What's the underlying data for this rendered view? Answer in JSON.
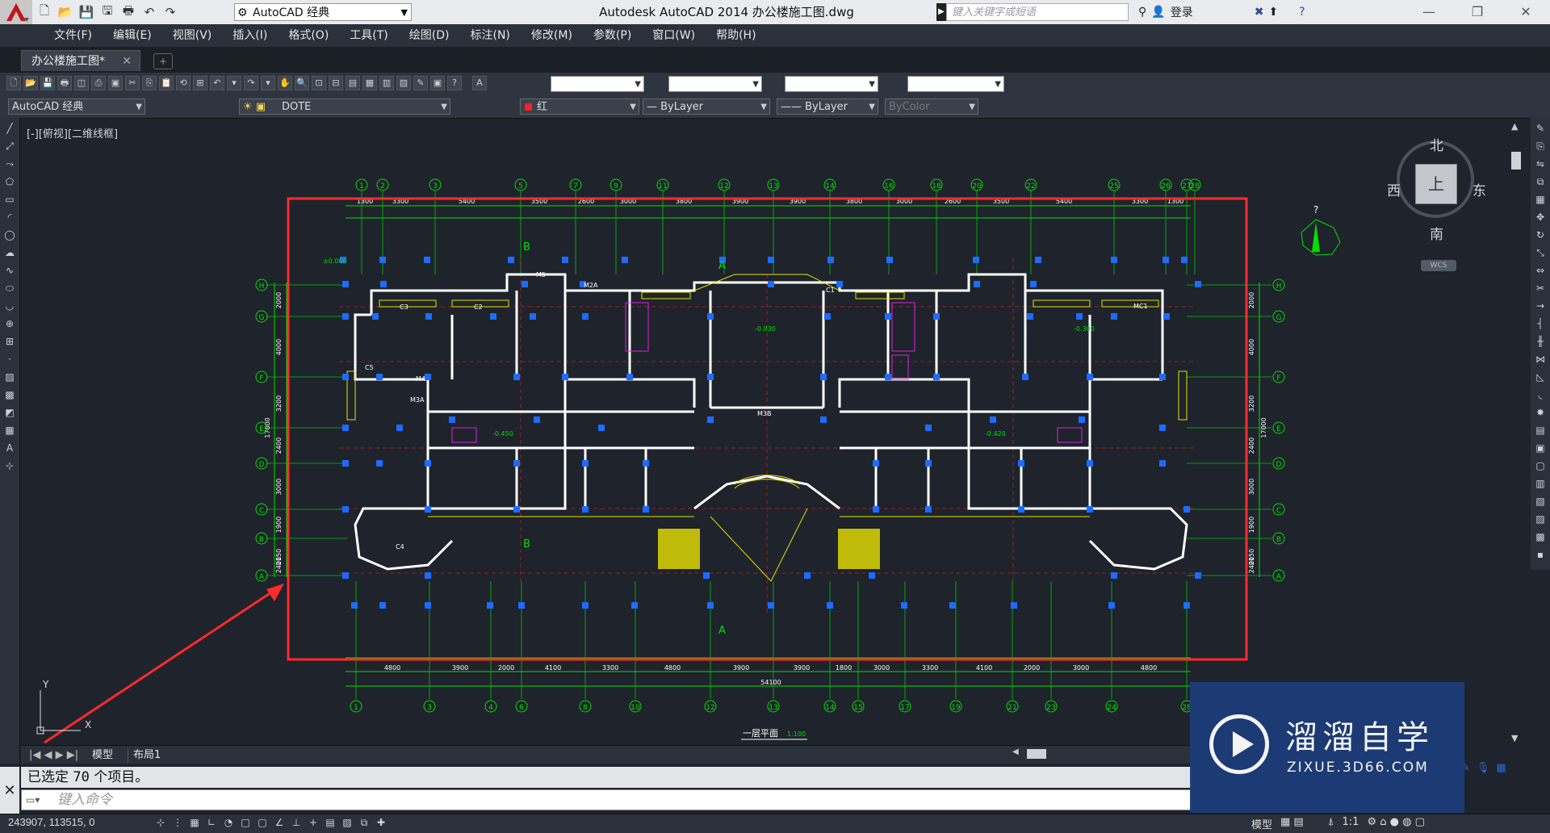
{
  "titlebar": {
    "workspace": "AutoCAD 经典",
    "window_title": "Autodesk AutoCAD 2014    办公楼施工图.dwg",
    "search_placeholder": "键入关键字或短语",
    "login_label": "登录"
  },
  "menu": {
    "items": [
      "文件(F)",
      "编辑(E)",
      "视图(V)",
      "插入(I)",
      "格式(O)",
      "工具(T)",
      "绘图(D)",
      "标注(N)",
      "修改(M)",
      "参数(P)",
      "窗口(W)",
      "帮助(H)"
    ]
  },
  "file_tab": {
    "label": "办公楼施工图*"
  },
  "toolbar2": {
    "workspace": "AutoCAD 经典",
    "layer": "DOTE",
    "color": "红",
    "linetype": "—  ByLayer",
    "lineweight": "—— ByLayer",
    "plotstyle": "ByColor"
  },
  "viewport_label": "[-][俯视][二维线框]",
  "viewcube": {
    "north": "北",
    "south": "南",
    "east": "东",
    "west": "西",
    "face": "上",
    "wcs": "WCS"
  },
  "drawing": {
    "title": "一层平面",
    "scale": "1:100",
    "grid_top": [
      "1",
      "2",
      "3",
      "5",
      "7",
      "9",
      "11",
      "12",
      "13",
      "14",
      "16",
      "18",
      "20",
      "22",
      "25",
      "26",
      "27",
      "28"
    ],
    "grid_bottom": [
      "1",
      "3",
      "4",
      "6",
      "8",
      "10",
      "12",
      "13",
      "14",
      "15",
      "17",
      "19",
      "21",
      "23",
      "24",
      "28"
    ],
    "grid_rows": [
      "H",
      "G",
      "F",
      "E",
      "D",
      "C",
      "B",
      "A"
    ],
    "total_dim": "54100",
    "top_dims": [
      "1300",
      "3300",
      "5400",
      "3500",
      "2600",
      "3000",
      "3800",
      "3900",
      "3900",
      "3800",
      "3000",
      "2600",
      "3500",
      "5400",
      "3300",
      "1300"
    ],
    "bottom_dims": [
      "4800",
      "3900",
      "2000",
      "4100",
      "3300",
      "4800",
      "3900",
      "3900",
      "1800",
      "3000",
      "3300",
      "4100",
      "2000",
      "3000",
      "4800"
    ],
    "side_dims": [
      "2000",
      "4000",
      "3200",
      "2400",
      "3000",
      "1900",
      "2150",
      "2400"
    ],
    "side_total": "17000",
    "room_labels": [
      "C1",
      "C2",
      "C3",
      "C4",
      "C5",
      "M4",
      "M3A",
      "M3B",
      "M5",
      "M2A",
      "MC1"
    ],
    "levels": [
      "±0.000",
      "-0.030",
      "-0.300",
      "-0.450",
      "-0.420"
    ],
    "north_label": "?"
  },
  "layout_tabs": {
    "model": "模型",
    "layout1": "布局1"
  },
  "command": {
    "history_prefix": "已选定",
    "history_count": "70",
    "history_suffix": "个项目。",
    "input_placeholder": "键入命令"
  },
  "status": {
    "coords": "243907, 113515, 0",
    "model": "模型",
    "scale": "1:1"
  },
  "watermark": {
    "title": "溜溜自学",
    "sub": "ZIXUE.3D66.COM"
  },
  "colors": {
    "highlight_frame": "#ff2a2a",
    "arrow": "#ff2a2a",
    "grips": "#1e6bff",
    "dims": "#00e000",
    "walls": "#ffffff",
    "hatch": "#e8e000"
  }
}
